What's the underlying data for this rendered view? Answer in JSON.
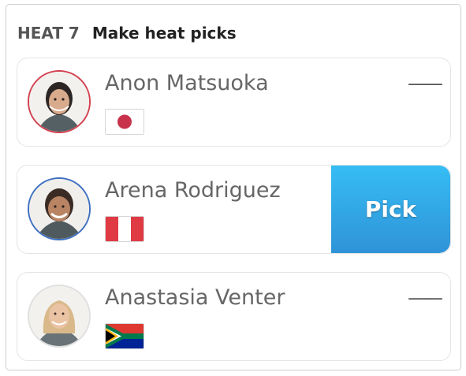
{
  "header": {
    "heat": "HEAT 7",
    "title": "Make heat picks"
  },
  "surfers": [
    {
      "name": "Anon Matsuoka",
      "flag_icon": "japan-flag-icon",
      "pick_status": "——"
    },
    {
      "name": "Arena Rodriguez",
      "flag_icon": "peru-flag-icon",
      "pick_label": "Pick"
    },
    {
      "name": "Anastasia Venter",
      "flag_icon": "south-africa-flag-icon",
      "pick_status": "——"
    }
  ],
  "colors": {
    "card1_avatar_ring": "#d34150",
    "card2_avatar_ring": "#3d6fc1",
    "pick_button_top": "#36bdf4",
    "pick_button_bottom": "#2f93d8"
  }
}
